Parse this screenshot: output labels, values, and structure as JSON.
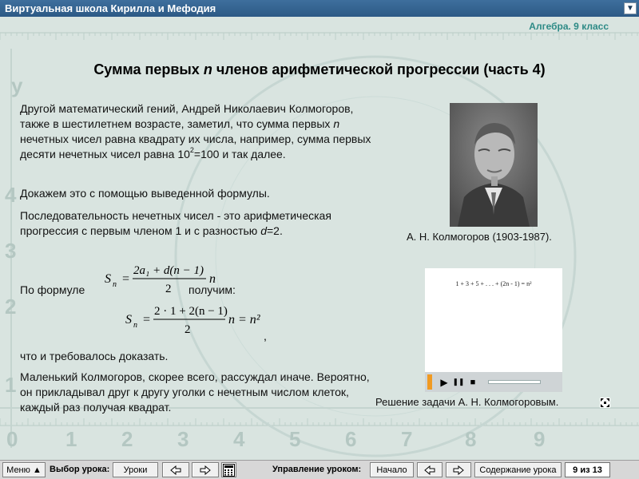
{
  "window": {
    "title": "Виртуальная школа Кирилла и Мефодия",
    "menu_glyph": "▼"
  },
  "header": {
    "subject": "Алгебра. 9 класс",
    "heading_pre": "Сумма первых ",
    "heading_var": "n",
    "heading_post": " членов арифметической прогрессии (часть 4)"
  },
  "background": {
    "axis_label": "y",
    "axis_digits": [
      "0",
      "1",
      "2",
      "3",
      "4",
      "5",
      "6",
      "7",
      "8",
      "9"
    ]
  },
  "content": {
    "p1_a": "Другой математический гений, Андрей Николаевич Колмогоров, также в шестилетнем возрасте, заметил, что сумма первых ",
    "p1_var": "n",
    "p1_b": " нечетных чисел равна квадрату их числа, например, сумма первых десяти нечетных чисел равна 10",
    "p1_sup": "2",
    "p1_c": "=100 и так далее.",
    "p2": "Докажем это с помощью выведенной формулы.",
    "p3_a": "Последовательность нечетных чисел - это арифметическая прогрессия с первым членом 1 и с разностью ",
    "p3_var": "d",
    "p3_b": "=2.",
    "p4_a": "По формуле",
    "p4_b": "получим:",
    "p5": "что и требовалось доказать.",
    "p6": "Маленький Колмогоров, скорее всего, рассуждал иначе. Вероятно, он прикладывал друг к другу уголки с нечетным числом клеток, каждый раз получая квадрат.",
    "comma": ","
  },
  "formula1": {
    "lhs": "S",
    "lhs_sub": "n",
    "eq": "=",
    "num": "2a₁ + d(n − 1)",
    "den": "2",
    "tail": "n"
  },
  "formula2": {
    "lhs": "S",
    "lhs_sub": "n",
    "eq": "=",
    "num": "2 · 1 + 2(n − 1)",
    "den": "2",
    "tail": "n = n²"
  },
  "portrait": {
    "caption": "А. Н. Колмогоров (1903-1987)."
  },
  "video": {
    "equation": "1 + 3 + 5 + . . . + (2n - 1) = n²",
    "play_glyph": "▶",
    "pause_glyph": "❚❚",
    "stop_glyph": "■",
    "caption": "Решение задачи А. Н. Колмогоровым."
  },
  "toolbar": {
    "menu_label": "Меню ▲",
    "lesson_select_label": "Выбор урока:",
    "lessons_button": "Уроки",
    "lesson_control_label": "Управление уроком:",
    "start_button": "Начало",
    "contents_button": "Содержание урока",
    "page_indicator": "9 из 13"
  }
}
